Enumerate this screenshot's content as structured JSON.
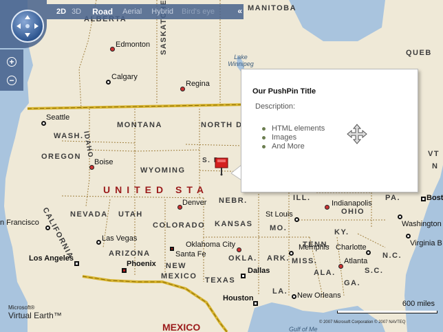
{
  "map_controls": {
    "modes": [
      "2D",
      "3D",
      "Road",
      "Aerial",
      "Hybrid",
      "Bird's eye"
    ],
    "active_mode": "Road",
    "collapse_label": "«",
    "zoom_in_label": "+",
    "zoom_out_label": "−"
  },
  "labels": {
    "country": "UNITED STA",
    "mexico": "MEXICO",
    "provinces": [
      "ALBERTA",
      "SASKATCHEWAN",
      "MANITOBA",
      "QUEB"
    ],
    "states": [
      "MONTANA",
      "NORTH DAKOTA",
      "WASH.",
      "IDAHO",
      "OREGON",
      "WYOMING",
      "S. D",
      "NEBR.",
      "NEVADA",
      "UTAH",
      "COLORADO",
      "KANSAS",
      "CALIFORNIA",
      "ARIZONA",
      "NEW MEXICO",
      "OKLA.",
      "TEXAS",
      "ARK.",
      "MISS.",
      "ALA.",
      "GA.",
      "LA.",
      "MO.",
      "KY.",
      "TENN.",
      "ILL.",
      "OHIO",
      "PA.",
      "N.C.",
      "S.C.",
      "VT",
      "N"
    ],
    "cities": [
      "Edmonton",
      "Calgary",
      "Regina",
      "Seattle",
      "Boise",
      "Denver",
      "n Francisco",
      "Las Vegas",
      "Los Angeles",
      "Phoenix",
      "Santa Fe",
      "Oklahoma City",
      "Dallas",
      "Houston",
      "St Louis",
      "Memphis",
      "Charlotte",
      "Atlanta",
      "New Orleans",
      "Indianapolis",
      "Washington",
      "Virginia B",
      "Boston"
    ],
    "water": [
      "Lake Winnipeg",
      "Gulf of Me"
    ]
  },
  "popup": {
    "title": "Our PushPin Title",
    "description_label": "Description:",
    "items": [
      "HTML elements",
      "Images",
      "And More"
    ]
  },
  "scale": {
    "label": "600 miles"
  },
  "branding": {
    "ms_label": "Microsoft®",
    "ve_label": "Virtual Earth™",
    "copyright": "© 2007 Microsoft Corporation   © 2007 NAVTEQ"
  },
  "colors": {
    "land": "#efe9d7",
    "water": "#a9c4de",
    "control_bar": "#46628c",
    "pushpin": "#d41f1f",
    "border": "#c9a227"
  }
}
